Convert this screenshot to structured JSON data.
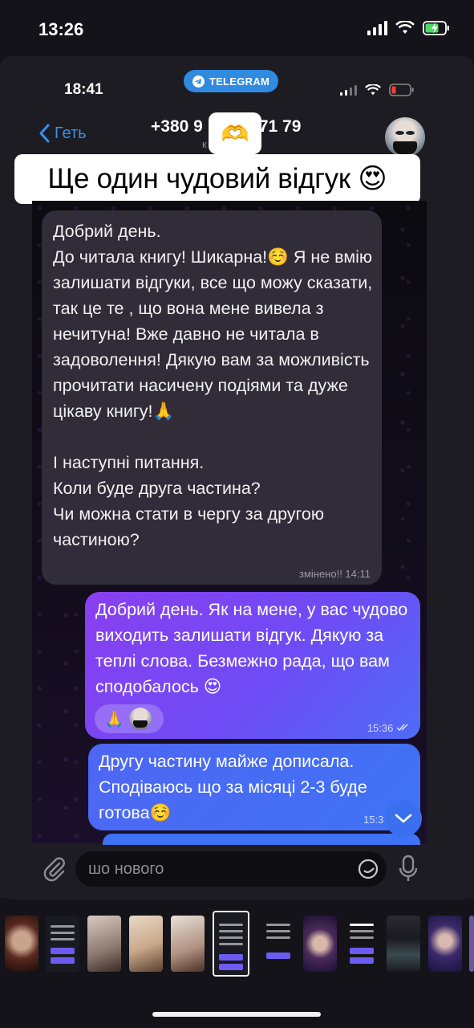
{
  "outer_status": {
    "time": "13:26"
  },
  "inner_status": {
    "time": "18:41",
    "app_pill": "TELEGRAM"
  },
  "header": {
    "back_label": "Геть",
    "contact_title": "+380 9",
    "contact_title_end": "71 79",
    "subtitle": "к",
    "emoji_badge": "🫶"
  },
  "caption": "Ще один чудовий відгук 😍",
  "messages": [
    {
      "direction": "incoming",
      "text": "Добрий день.\nДо читала книгу! Шикарна!☺️ Я не вмію залишати відгуки, все що можу сказати, так це те , що вона мене вивела з нечитуна! Вже давно не читала в задоволення! Дякую вам за можливість прочитати насичену подіями та дуже цікаву книгу!🙏\n\nІ наступні питання.\nКоли буде друга частина?\nЧи можна стати в чергу за другою частиною?",
      "meta": "змінено!! 14:11"
    },
    {
      "direction": "outgoing",
      "text": "Добрий день. Як на мене, у вас чудово виходить залишати відгук. Дякую за теплі слова. Безмежно рада, що вам сподобалось 😍",
      "reaction": "🙏",
      "meta": "15:36"
    },
    {
      "direction": "outgoing",
      "text": "Другу частину майже дописала. Сподіваюсь що за місяці 2-3 буде готова☺️",
      "meta": "15:3"
    }
  ],
  "input": {
    "placeholder": "шо нового"
  },
  "colors": {
    "accent_blue": "#3d8fe6",
    "telegram_pill": "#2f8ae0",
    "outgoing_gradient_start": "#8a3ff0",
    "outgoing_gradient_end": "#3f73f5",
    "incoming_bubble": "#34303c"
  },
  "icons": [
    "signal-icon",
    "wifi-icon",
    "battery-charging-icon",
    "telegram-icon",
    "battery-low-icon",
    "chevron-left-icon",
    "paperclip-icon",
    "sticker-icon",
    "microphone-icon",
    "chevron-down-icon"
  ]
}
